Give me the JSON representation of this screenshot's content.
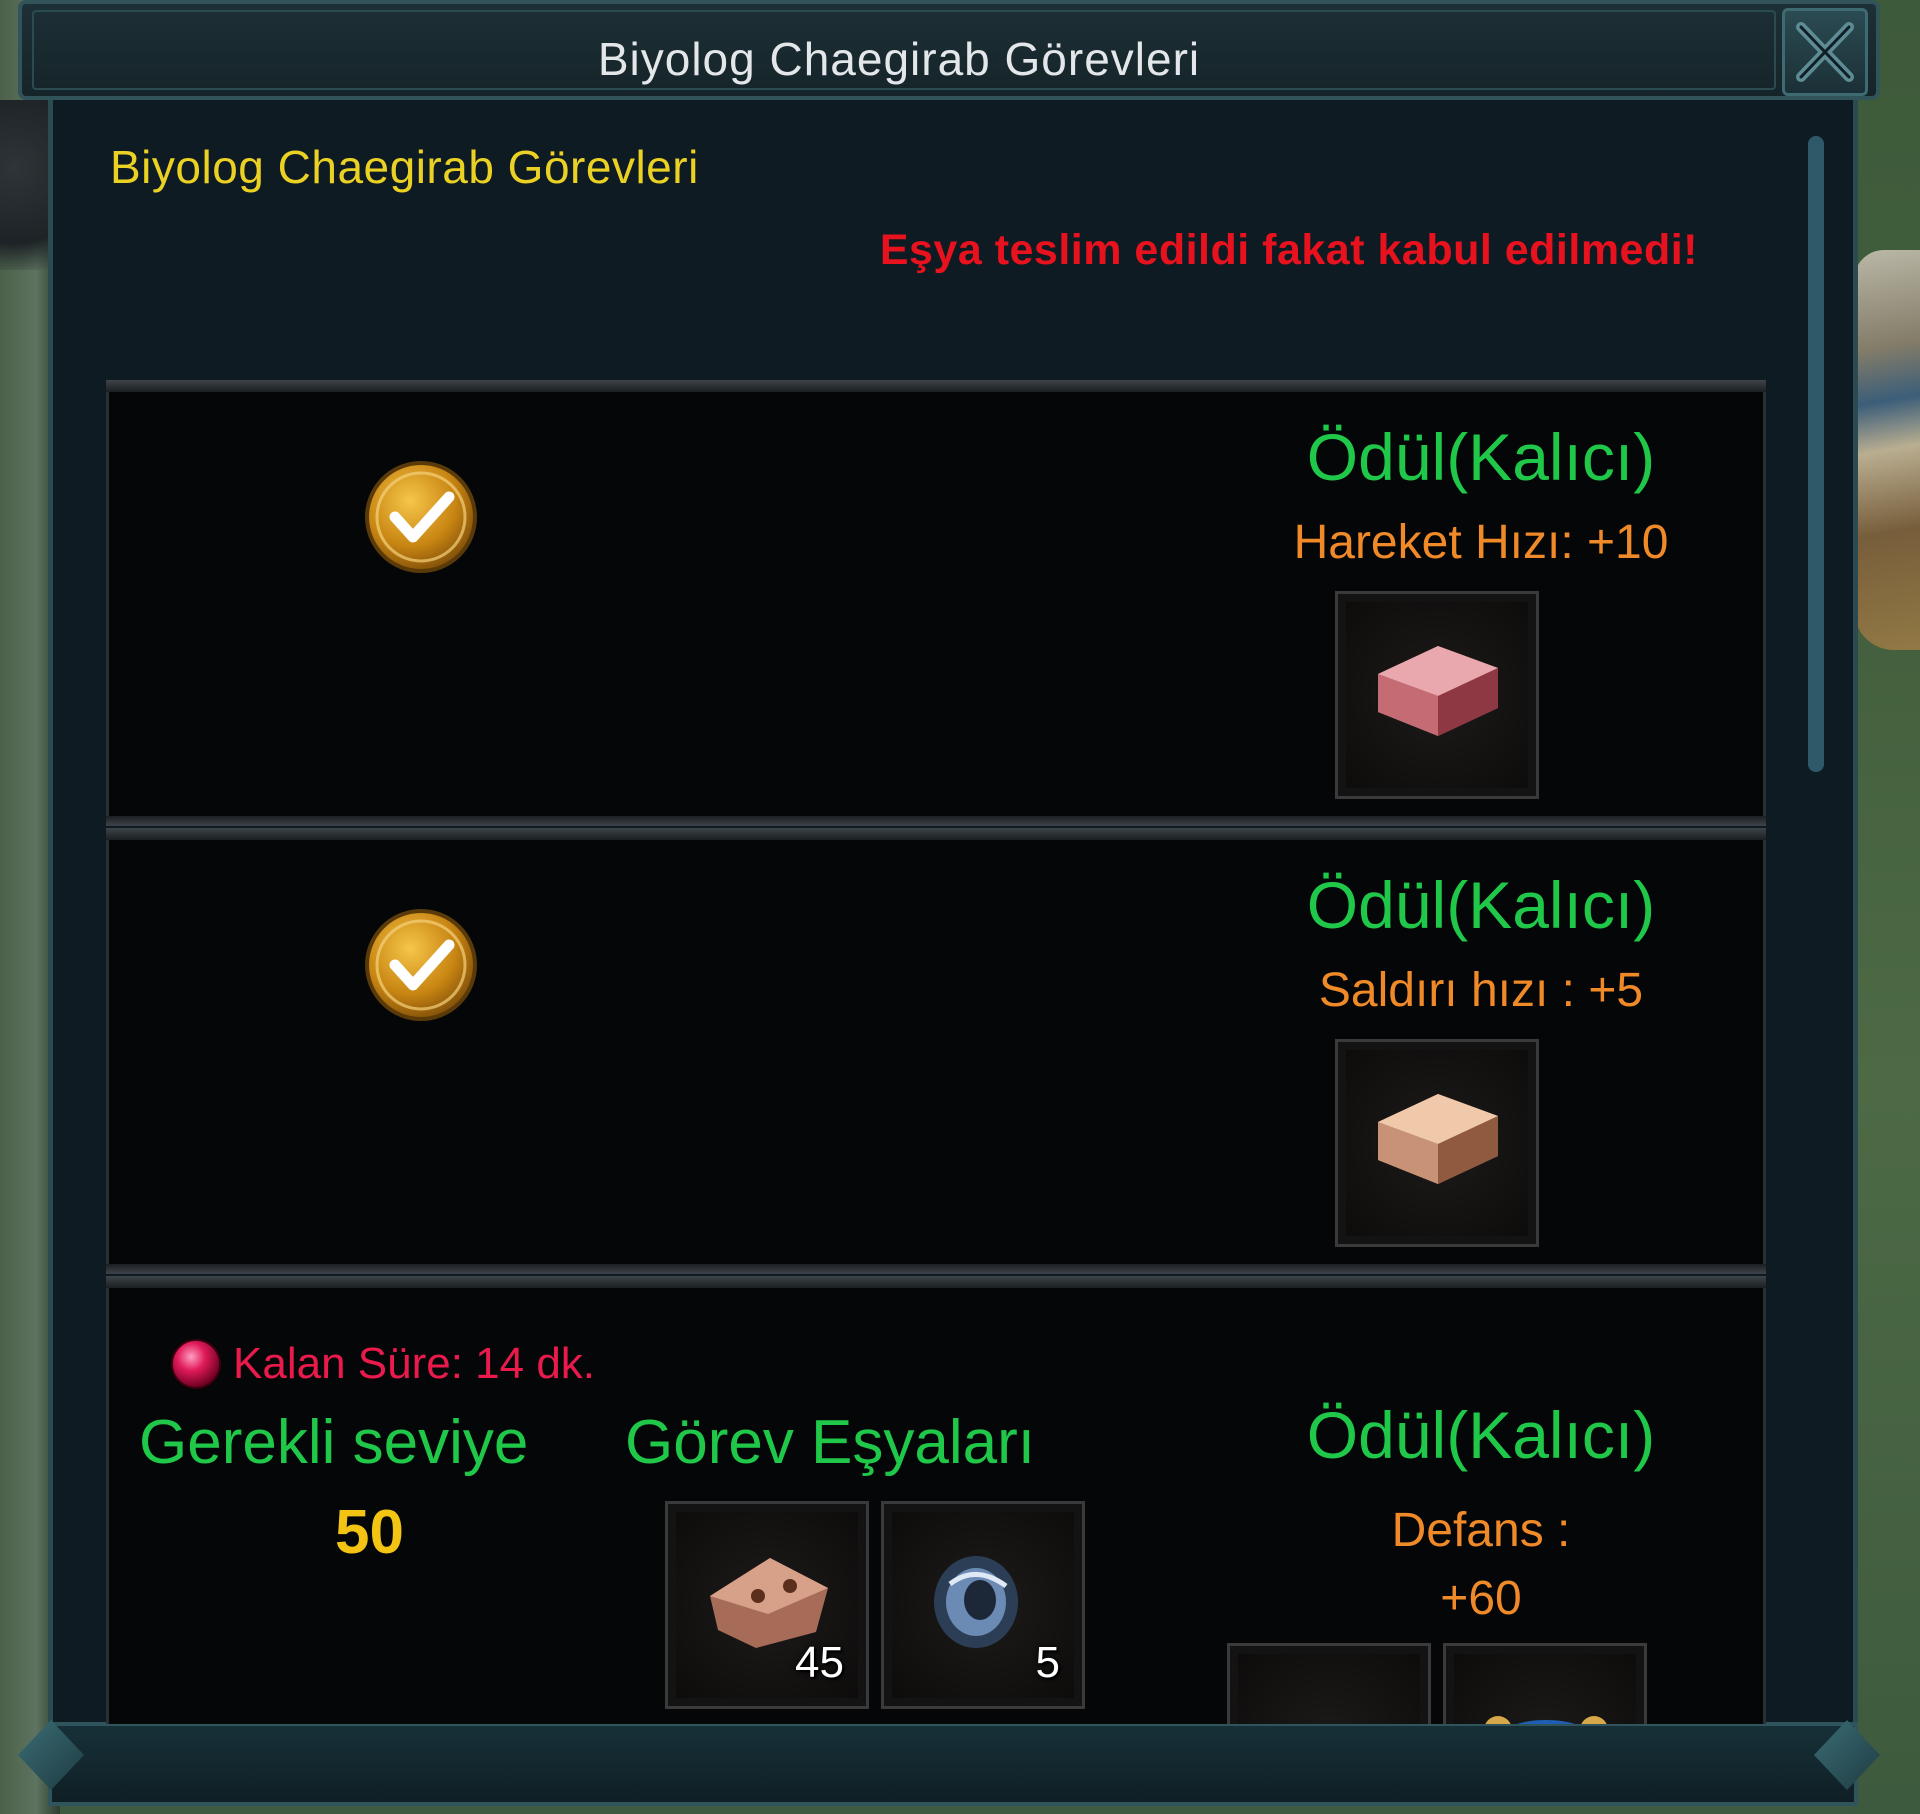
{
  "window": {
    "title": "Biyolog Chaegirab Görevleri"
  },
  "header": {
    "title": "Biyolog Chaegirab Görevleri",
    "error_message": "Eşya teslim edildi fakat kabul edilmedi!"
  },
  "quests": [
    {
      "status": "completed",
      "status_icon": "gold-checkmark-icon",
      "reward_title": "Ödül(Kalıcı)",
      "reward_stat": "Hareket Hızı: +10",
      "reward_items": [
        {
          "icon": "red-block-item-icon"
        }
      ]
    },
    {
      "status": "completed",
      "status_icon": "gold-checkmark-icon",
      "reward_title": "Ödül(Kalıcı)",
      "reward_stat": "Saldırı hızı : +5",
      "reward_items": [
        {
          "icon": "tan-block-item-icon"
        }
      ]
    },
    {
      "status": "active",
      "timer_label": "Kalan Süre: 14 dk.",
      "required_level_label": "Gerekli seviye",
      "required_level_value": "50",
      "quest_items_label": "Görev Eşyaları",
      "quest_items": [
        {
          "icon": "leather-pouch-item-icon",
          "count": "45"
        },
        {
          "icon": "blue-ring-item-icon",
          "count": "5"
        }
      ],
      "reward_title": "Ödül(Kalıcı)",
      "reward_stat_line1": "Defans :",
      "reward_stat_line2": "+60",
      "reward_items": [
        {
          "icon": "gold-item-icon"
        },
        {
          "icon": "blue-gold-armor-item-icon"
        }
      ]
    }
  ],
  "colors": {
    "header_yellow": "#ebd124",
    "error_red": "#e8121e",
    "reward_green": "#20c849",
    "stat_orange": "#f08a28",
    "timer_red": "#ea1a4d",
    "level_gold": "#f3c414"
  }
}
